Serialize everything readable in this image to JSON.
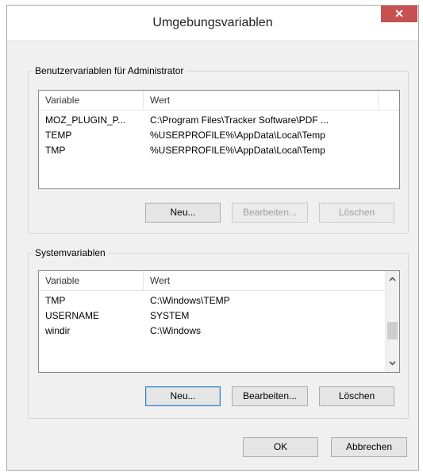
{
  "window": {
    "title": "Umgebungsvariablen",
    "close_glyph": "✕"
  },
  "user_vars": {
    "label": "Benutzervariablen für Administrator",
    "columns": [
      "Variable",
      "Wert"
    ],
    "rows": [
      {
        "name": "MOZ_PLUGIN_P...",
        "value": "C:\\Program Files\\Tracker Software\\PDF ..."
      },
      {
        "name": "TEMP",
        "value": "%USERPROFILE%\\AppData\\Local\\Temp"
      },
      {
        "name": "TMP",
        "value": "%USERPROFILE%\\AppData\\Local\\Temp"
      }
    ],
    "buttons": {
      "new": "Neu...",
      "edit": "Bearbeiten...",
      "delete": "Löschen"
    }
  },
  "system_vars": {
    "label": "Systemvariablen",
    "columns": [
      "Variable",
      "Wert"
    ],
    "rows": [
      {
        "name": "TMP",
        "value": "C:\\Windows\\TEMP"
      },
      {
        "name": "USERNAME",
        "value": "SYSTEM"
      },
      {
        "name": "windir",
        "value": "C:\\Windows"
      }
    ],
    "buttons": {
      "new": "Neu...",
      "edit": "Bearbeiten...",
      "delete": "Löschen"
    }
  },
  "footer": {
    "ok": "OK",
    "cancel": "Abbrechen"
  },
  "icons": {
    "scroll_up": "chevron-up-icon",
    "scroll_down": "chevron-down-icon"
  },
  "colors": {
    "close_button": "#c75050",
    "dialog_bg": "#f0f0f0"
  }
}
